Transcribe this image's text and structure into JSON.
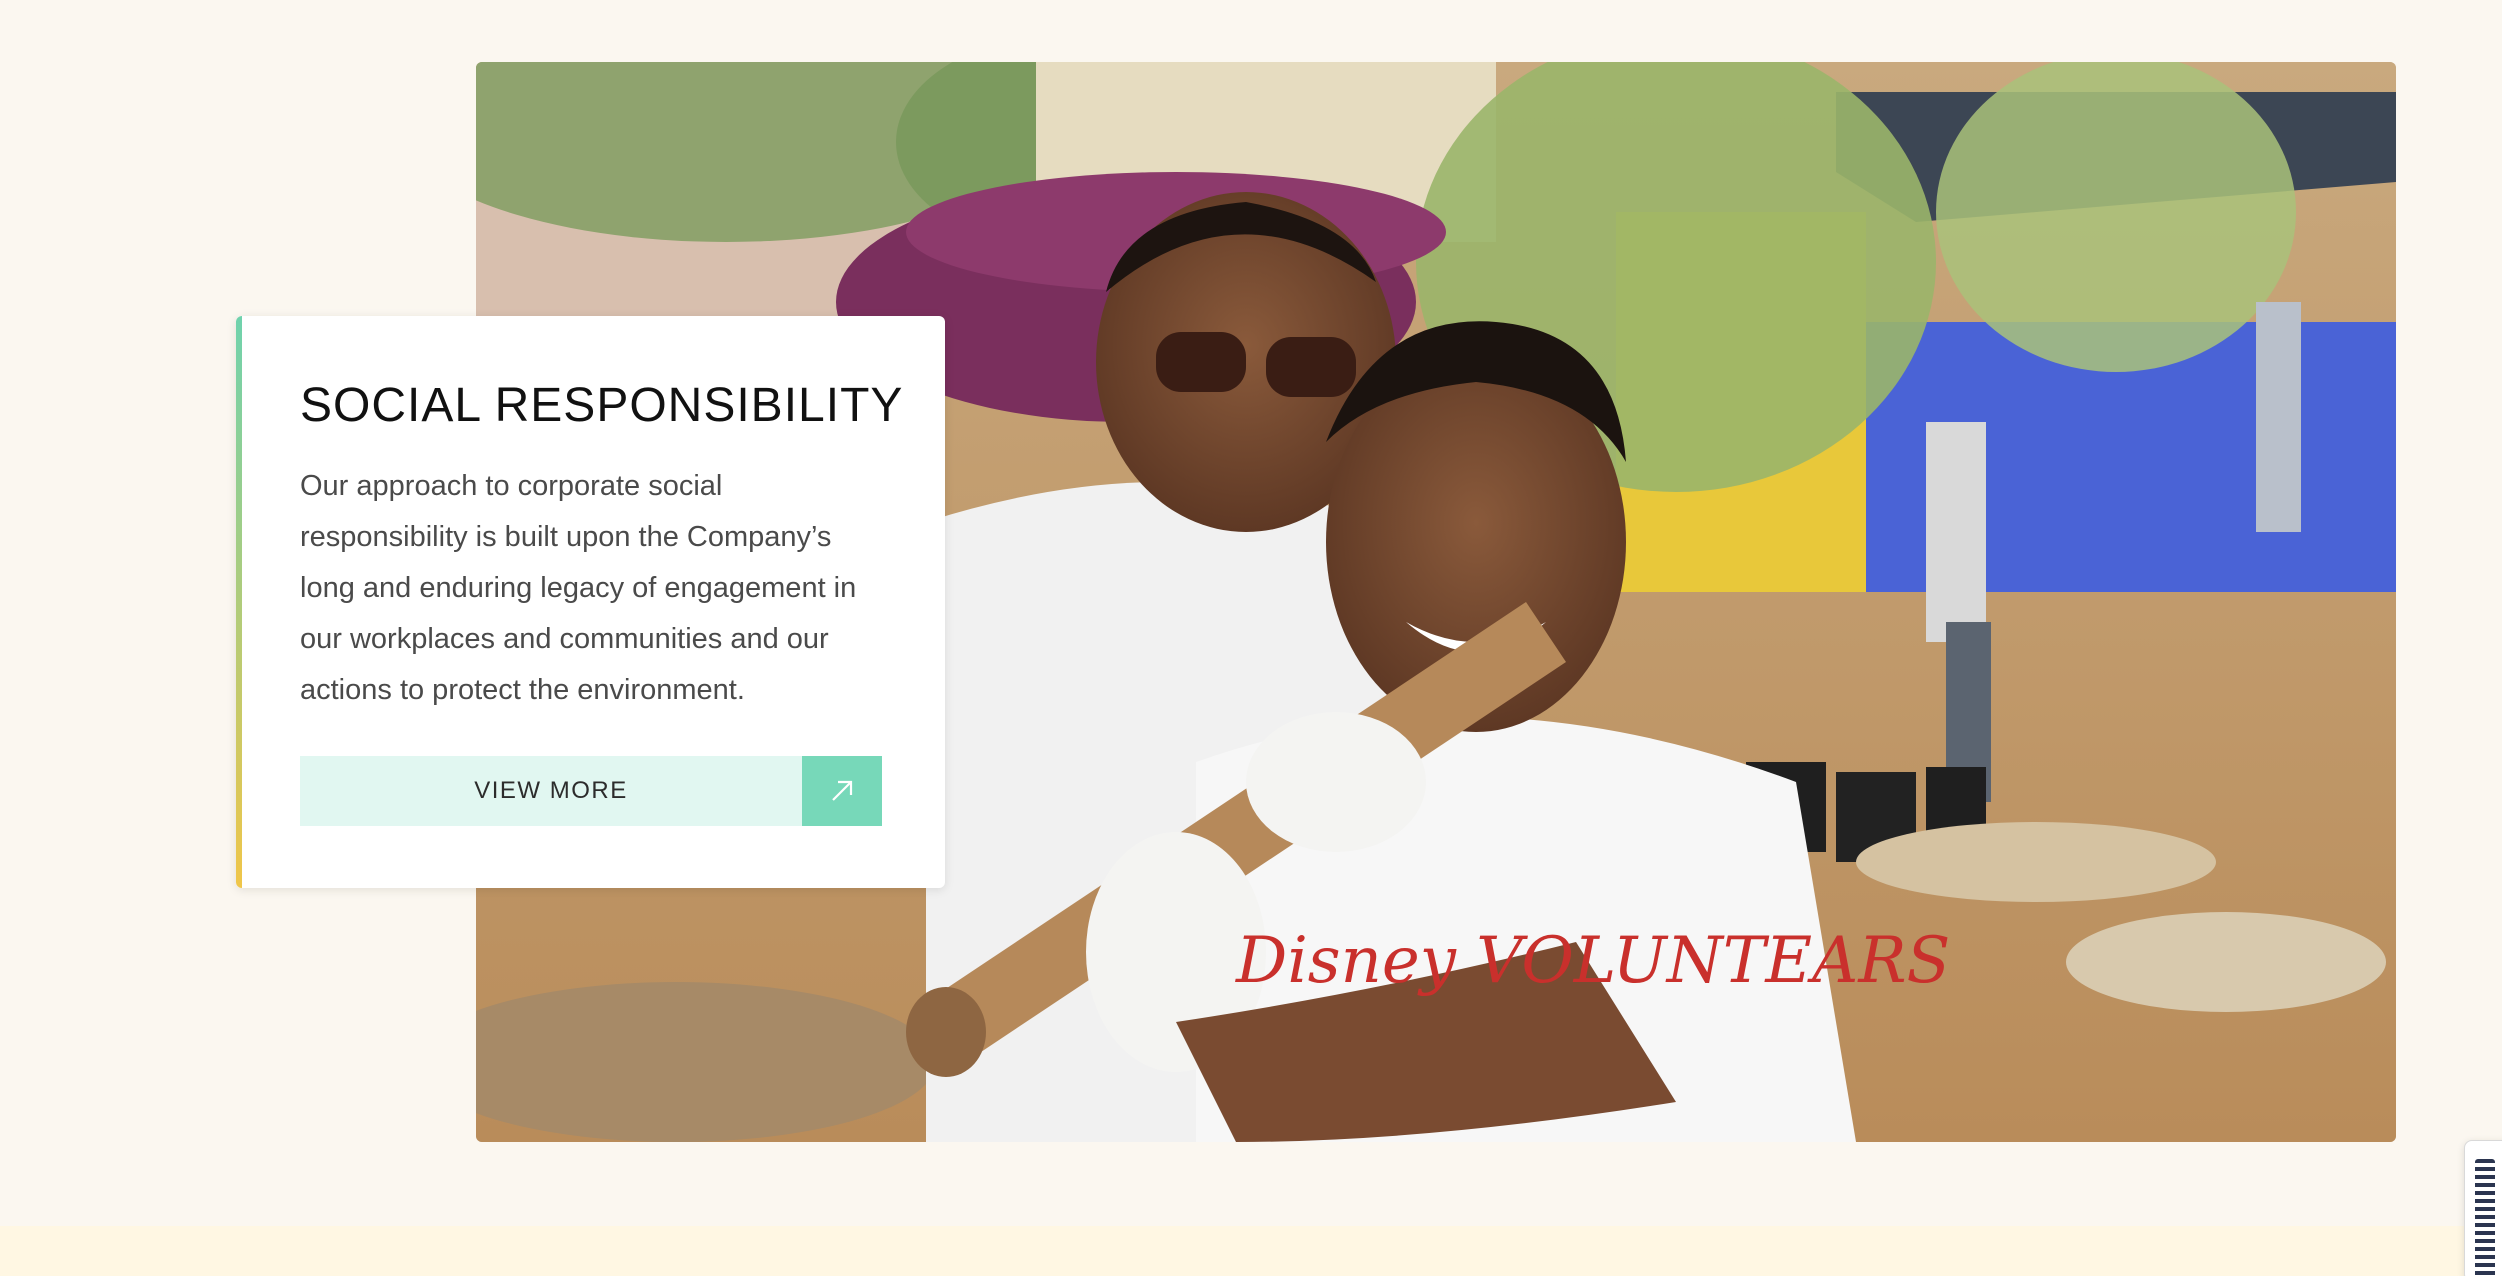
{
  "hero": {
    "image_alt": "Two smiling volunteers in white Disney VoluntEARS t-shirts carrying a tub and a wooden tool outdoors",
    "shirt_text": "Disney VOLUNTEARS"
  },
  "card": {
    "title": "SOCIAL RESPONSIBILITY",
    "body": "Our approach to corporate social responsibility is built upon the Company’s long and enduring legacy of engagement in our workplaces and communities and our actions to protect the environment.",
    "cta_label": "VIEW MORE",
    "cta_icon": "arrow-up-right-icon"
  },
  "colors": {
    "page_bg": "#fbf7f0",
    "card_bg": "#ffffff",
    "accent_top": "#6fd2ad",
    "accent_bottom": "#f0c649",
    "cta_bg": "#e1f7f1",
    "cta_icon_bg": "#77d8b9",
    "band_bg": "#fff7e3"
  }
}
